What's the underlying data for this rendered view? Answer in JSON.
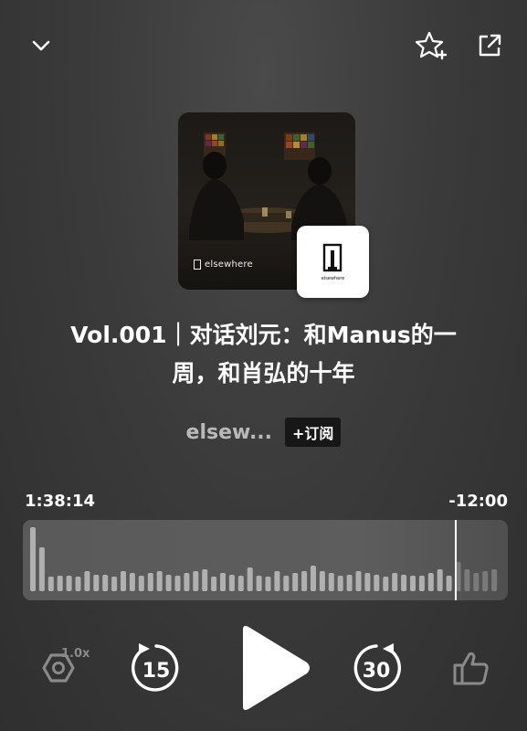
{
  "header": {
    "collapse_icon": "chevron-down-icon",
    "favorite_icon": "star-add-icon",
    "share_icon": "share-external-icon"
  },
  "cover": {
    "brand_text": "elsewhere",
    "badge_text": "elsewhere"
  },
  "episode": {
    "title_line1": "Vol.001｜对话刘元：和Manus的一",
    "title_line2": "周，和肖弘的十年"
  },
  "author": {
    "name": "elsew...",
    "subscribe_label": "+订阅"
  },
  "player": {
    "elapsed": "1:38:14",
    "remaining": "-12:00",
    "progress_fraction": 0.891,
    "speed_label": "1.0x",
    "rewind_seconds": "15",
    "forward_seconds": "30"
  },
  "colors": {
    "background": "#3b3b3b",
    "text": "#ffffff",
    "muted": "#b9b9b9",
    "wave_played": "#b0b0b0",
    "wave_unplayed": "#7a7a7a"
  }
}
